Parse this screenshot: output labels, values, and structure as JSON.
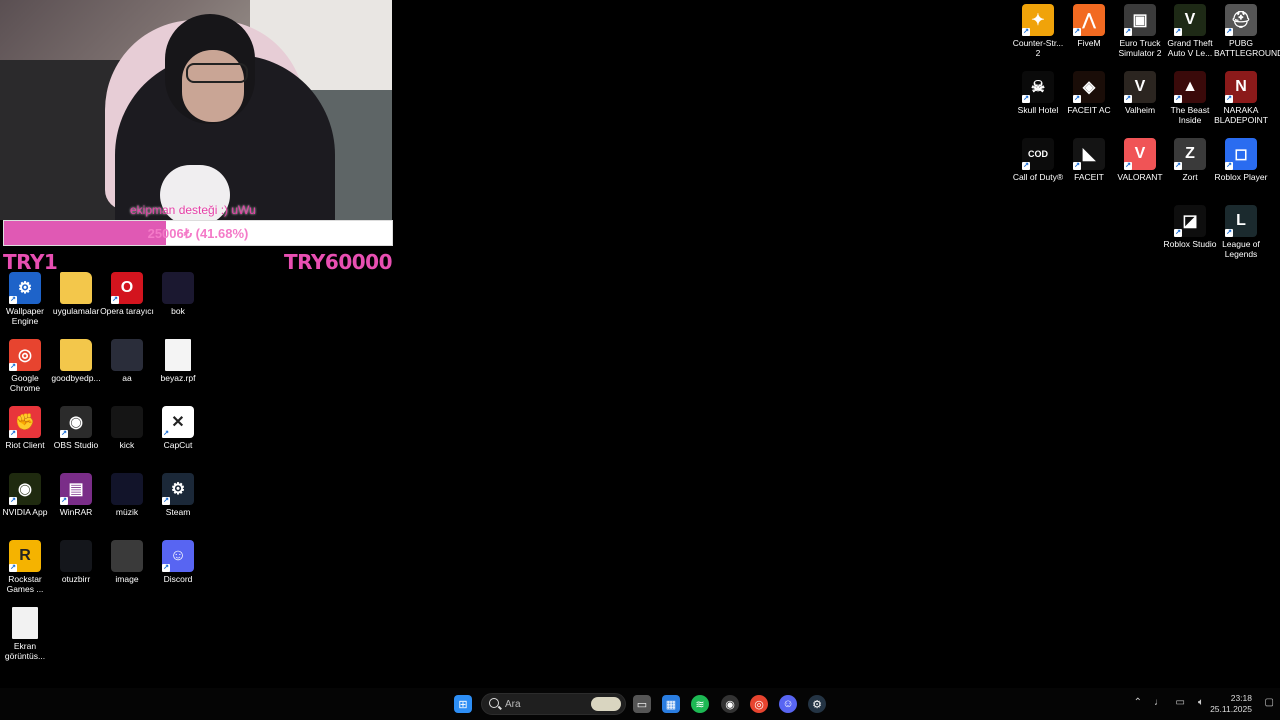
{
  "overlay": {
    "alert_text": "ekipman desteği :) uWu",
    "goal_text": "25006₺ (41.68%)",
    "goal_progress": 0.4168,
    "goal_min": "TRY1",
    "goal_max": "TRY60000"
  },
  "desktop_left": [
    {
      "label": "Wallpaper Engine",
      "icon": "wallpaper-engine-icon",
      "color": "#1e63c9",
      "glyph": "⚙",
      "shortcut": true
    },
    {
      "label": "uygulamalar",
      "icon": "folder-icon",
      "color": "#f3c74b",
      "glyph": "",
      "shortcut": false
    },
    {
      "label": "Opera tarayıcı",
      "icon": "opera-icon",
      "color": "#d3141e",
      "glyph": "O",
      "shortcut": true
    },
    {
      "label": "bok",
      "icon": "image-thumbnail-icon",
      "color": "#1b1830",
      "glyph": "",
      "shortcut": false
    },
    {
      "label": "Google Chrome",
      "icon": "chrome-icon",
      "color": "#e7442f",
      "glyph": "◎",
      "shortcut": true
    },
    {
      "label": "goodbyedp...",
      "icon": "folder-icon",
      "color": "#f3c74b",
      "glyph": "",
      "shortcut": false
    },
    {
      "label": "aa",
      "icon": "image-thumbnail-icon",
      "color": "#2a2d3a",
      "glyph": "",
      "shortcut": false
    },
    {
      "label": "beyaz.rpf",
      "icon": "file-icon",
      "color": "#f4f4f4",
      "glyph": "",
      "shortcut": false
    },
    {
      "label": "Riot Client",
      "icon": "riot-client-icon",
      "color": "#e8353b",
      "glyph": "✊",
      "shortcut": true
    },
    {
      "label": "OBS Studio",
      "icon": "obs-icon",
      "color": "#2b2b2b",
      "glyph": "◉",
      "shortcut": true
    },
    {
      "label": "kick",
      "icon": "image-thumbnail-icon",
      "color": "#151515",
      "glyph": "",
      "shortcut": false
    },
    {
      "label": "CapCut",
      "icon": "capcut-icon",
      "color": "#ffffff",
      "glyph": "✕",
      "shortcut": true
    },
    {
      "label": "NVIDIA App",
      "icon": "nvidia-icon",
      "color": "#1f2a0f",
      "glyph": "◉",
      "shortcut": true
    },
    {
      "label": "WinRAR",
      "icon": "winrar-icon",
      "color": "#7a2d88",
      "glyph": "▤",
      "shortcut": true
    },
    {
      "label": "müzik",
      "icon": "image-thumbnail-icon",
      "color": "#12142a",
      "glyph": "",
      "shortcut": false
    },
    {
      "label": "Steam",
      "icon": "steam-icon",
      "color": "#1b2838",
      "glyph": "⚙",
      "shortcut": true
    },
    {
      "label": "Rockstar Games ...",
      "icon": "rockstar-icon",
      "color": "#f5b300",
      "glyph": "R",
      "shortcut": true
    },
    {
      "label": "otuzbirr",
      "icon": "image-thumbnail-icon",
      "color": "#14161b",
      "glyph": "",
      "shortcut": false
    },
    {
      "label": "image",
      "icon": "image-thumbnail-icon",
      "color": "#3a3a3a",
      "glyph": "",
      "shortcut": false
    },
    {
      "label": "Discord",
      "icon": "discord-icon",
      "color": "#5865f2",
      "glyph": "☺",
      "shortcut": true
    },
    {
      "label": "Ekran görüntüs...",
      "icon": "document-thumbnail-icon",
      "color": "#f2f2f2",
      "glyph": "",
      "shortcut": false
    }
  ],
  "desktop_right": [
    {
      "label": "Counter-Str... 2",
      "icon": "counter-strike-icon",
      "color": "#f0a30a",
      "glyph": "✦",
      "shortcut": true
    },
    {
      "label": "FiveM",
      "icon": "fivem-icon",
      "color": "#f26a21",
      "glyph": "⋀",
      "shortcut": true
    },
    {
      "label": "Euro Truck Simulator 2",
      "icon": "euro-truck-icon",
      "color": "#3b3b3b",
      "glyph": "▣",
      "shortcut": true
    },
    {
      "label": "Grand Theft Auto V Le...",
      "icon": "gta-v-icon",
      "color": "#1e2a16",
      "glyph": "V",
      "shortcut": true
    },
    {
      "label": "PUBG BATTLEGROUNDS",
      "icon": "pubg-icon",
      "color": "#555",
      "glyph": "⛑",
      "shortcut": true
    },
    {
      "label": "Skull Hotel",
      "icon": "skull-hotel-icon",
      "color": "#0a0a0a",
      "glyph": "☠",
      "shortcut": true
    },
    {
      "label": "FACEIT AC",
      "icon": "faceit-ac-icon",
      "color": "#1a0d08",
      "glyph": "◈",
      "shortcut": true
    },
    {
      "label": "Valheim",
      "icon": "valheim-icon",
      "color": "#2b2520",
      "glyph": "V",
      "shortcut": true
    },
    {
      "label": "The Beast Inside",
      "icon": "beast-inside-icon",
      "color": "#3a0a0a",
      "glyph": "▲",
      "shortcut": true
    },
    {
      "label": "NARAKA BLADEPOINT",
      "icon": "naraka-icon",
      "color": "#8b1a1a",
      "glyph": "N",
      "shortcut": true
    },
    {
      "label": "Call of Duty®",
      "icon": "call-of-duty-icon",
      "color": "#0c0c0c",
      "glyph": "COD",
      "shortcut": true
    },
    {
      "label": "FACEIT",
      "icon": "faceit-icon",
      "color": "#141414",
      "glyph": "◣",
      "shortcut": true
    },
    {
      "label": "VALORANT",
      "icon": "valorant-icon",
      "color": "#f05456",
      "glyph": "V",
      "shortcut": true
    },
    {
      "label": "Zort",
      "icon": "zort-icon",
      "color": "#3a3a3a",
      "glyph": "Z",
      "shortcut": true
    },
    {
      "label": "Roblox Player",
      "icon": "roblox-player-icon",
      "color": "#2a6cf0",
      "glyph": "◻",
      "shortcut": true
    },
    {
      "label": "Roblox Studio",
      "icon": "roblox-studio-icon",
      "color": "#0e0e0e",
      "glyph": "◪",
      "shortcut": true
    },
    {
      "label": "League of Legends",
      "icon": "league-of-legends-icon",
      "color": "#1b2a2e",
      "glyph": "L",
      "shortcut": true
    }
  ],
  "taskbar": {
    "search_placeholder": "Ara",
    "apps": [
      {
        "icon": "windows-start-icon",
        "color": "#2d8ef5",
        "glyph": "⊞"
      },
      {
        "icon": "task-view-icon",
        "color": "#555",
        "glyph": "▭"
      },
      {
        "icon": "microsoft-store-icon",
        "color": "#2a7de1",
        "glyph": "▦"
      },
      {
        "icon": "spotify-icon",
        "color": "#1db954",
        "glyph": "≋"
      },
      {
        "icon": "obs-icon",
        "color": "#333",
        "glyph": "◉"
      },
      {
        "icon": "chrome-icon",
        "color": "#e7442f",
        "glyph": "◎"
      },
      {
        "icon": "discord-icon",
        "color": "#5865f2",
        "glyph": "☺"
      },
      {
        "icon": "steam-icon",
        "color": "#243444",
        "glyph": "⚙"
      }
    ],
    "time": "23:18",
    "date": "25.11.2025"
  }
}
